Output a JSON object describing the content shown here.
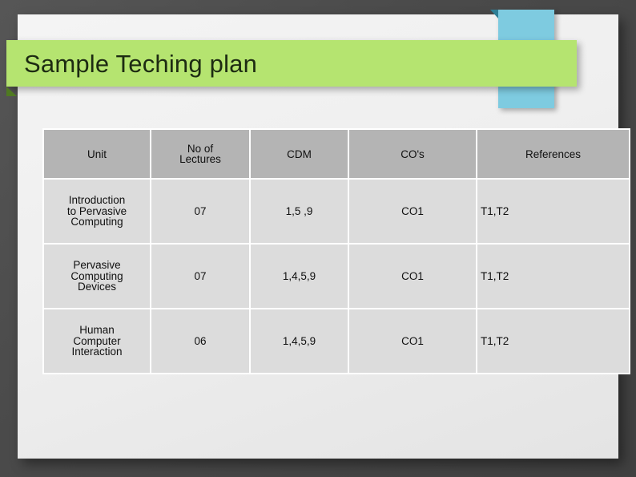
{
  "slide": {
    "title": "Sample Teching plan",
    "accent_green": "#b5e470",
    "accent_blue": "#7ecbe0",
    "background": "#4d4d4d",
    "sheet": "#efefef"
  },
  "table": {
    "header_background": "#b4b4b4",
    "cell_background": "#dcdcdc",
    "border_color": "#ffffff",
    "columns": [
      {
        "key": "unit",
        "label": "Unit"
      },
      {
        "key": "lectures",
        "label_line1": "No of",
        "label_line2": "Lectures"
      },
      {
        "key": "cdm",
        "label": "CDM"
      },
      {
        "key": "cos",
        "label": "CO's"
      },
      {
        "key": "references",
        "label": "References"
      }
    ],
    "rows": [
      {
        "unit_line1": "Introduction",
        "unit_line2": "to Pervasive",
        "unit_line3": "Computing",
        "lectures": "07",
        "cdm": "1,5 ,9",
        "cos": "CO1",
        "references": "T1,T2"
      },
      {
        "unit_line1": "Pervasive",
        "unit_line2": "Computing",
        "unit_line3": "Devices",
        "lectures": "07",
        "cdm": "1,4,5,9",
        "cos": "CO1",
        "references": "T1,T2"
      },
      {
        "unit_line1": "Human",
        "unit_line2": "Computer",
        "unit_line3": "Interaction",
        "lectures": "06",
        "cdm": "1,4,5,9",
        "cos": "CO1",
        "references": "T1,T2"
      }
    ]
  }
}
